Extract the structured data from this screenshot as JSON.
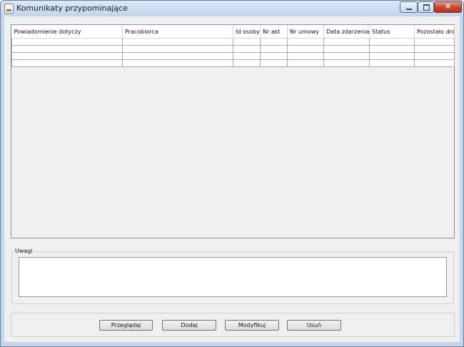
{
  "window": {
    "title": "Komunikaty przypominające",
    "controls": {
      "minimize": "minimize",
      "maximize": "maximize",
      "close": "✕"
    }
  },
  "table": {
    "columns": [
      "Powiadomienie dotyczy",
      "Pracobiorca",
      "Id osoby",
      "Nr akt",
      "Nr umowy",
      "Data zdarzenia",
      "Status",
      "Pozostało dni"
    ],
    "rows": [
      [
        "",
        "",
        "",
        "",
        "",
        "",
        "",
        ""
      ],
      [
        "",
        "",
        "",
        "",
        "",
        "",
        "",
        ""
      ],
      [
        "",
        "",
        "",
        "",
        "",
        "",
        "",
        ""
      ],
      [
        "",
        "",
        "",
        "",
        "",
        "",
        "",
        ""
      ]
    ]
  },
  "notes": {
    "legend": "Uwagi",
    "value": ""
  },
  "buttons": {
    "browse": "Przeglądaj",
    "add": "Dodaj",
    "modify": "Modyfikuj",
    "delete": "Usuń"
  }
}
